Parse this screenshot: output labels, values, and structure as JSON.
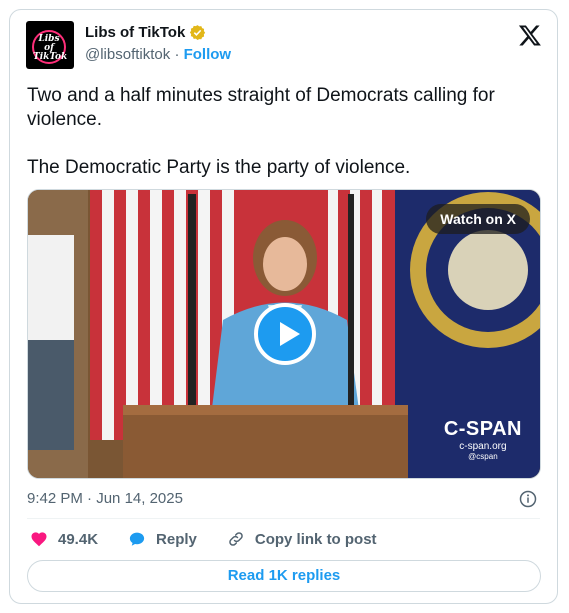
{
  "account": {
    "avatar_text": "Libs of TikTok",
    "name": "Libs of TikTok",
    "handle": "@libsoftiktok",
    "separator": "·",
    "follow_label": "Follow"
  },
  "tweet": {
    "text_lines": [
      "Two and a half minutes straight of Democrats calling for violence.",
      "The Democratic Party is the party of violence."
    ]
  },
  "media": {
    "watch_label": "Watch on X",
    "overlay_network": "C-SPAN",
    "overlay_site": "c-span.org",
    "overlay_handle": "@cspan",
    "play_icon": "play-icon"
  },
  "meta": {
    "time": "9:42 PM",
    "separator": "·",
    "date": "Jun 14, 2025"
  },
  "actions": {
    "likes_count": "49.4K",
    "reply_label": "Reply",
    "copy_link_label": "Copy link to post"
  },
  "footer": {
    "read_replies_label": "Read 1K replies"
  },
  "colors": {
    "accent": "#1d9bf0",
    "like": "#f91880",
    "text": "#0f1419",
    "muted": "#536471",
    "border": "#cfd9de"
  }
}
